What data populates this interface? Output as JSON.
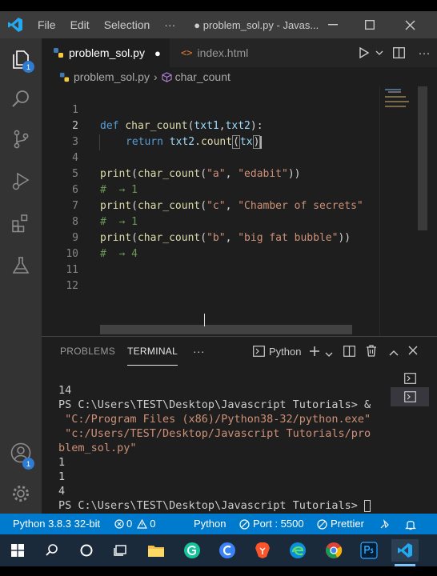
{
  "window": {
    "menu": [
      "File",
      "Edit",
      "Selection",
      "···"
    ],
    "title": "● problem_sol.py - Javas..."
  },
  "activity_bar": {
    "explorer_badge": "1",
    "accounts_badge": "1"
  },
  "tabs": [
    {
      "label": "problem_sol.py",
      "modified_marker": "●",
      "icon": "python-file-icon",
      "active": true
    },
    {
      "label": "index.html",
      "icon": "html-file-icon",
      "active": false
    }
  ],
  "breadcrumb": {
    "file": "problem_sol.py",
    "sep": "›",
    "symbol": "char_count"
  },
  "editor": {
    "line_numbers": [
      "1",
      "2",
      "3",
      "4",
      "5",
      "6",
      "7",
      "8",
      "9",
      "10",
      "11",
      "12"
    ],
    "lines": {
      "l1": {
        "kw": "def",
        "fn": "char_count",
        "p1": "(",
        "a1": "txt1",
        "c": ",",
        "a2": "txt2",
        "p2": "):"
      },
      "l2": {
        "kw": "return",
        "v": "txt2",
        "dot": ".",
        "fn": "count",
        "open": "(",
        "arg": "tx",
        "close": ")"
      },
      "l4": {
        "fn": "print",
        "p1": "(",
        "fn2": "char_count",
        "p2": "(",
        "s1": "\"a\"",
        "c": ", ",
        "s2": "\"edabit\"",
        "p3": "))"
      },
      "l5": {
        "cm": "#  → 1"
      },
      "l6": {
        "fn": "print",
        "p1": "(",
        "fn2": "char_count",
        "p2": "(",
        "s1": "\"c\"",
        "c": ", ",
        "s2": "\"Chamber of secrets\""
      },
      "l7": {
        "cm": "#  → 1"
      },
      "l8": {
        "fn": "print",
        "p1": "(",
        "fn2": "char_count",
        "p2": "(",
        "s1": "\"b\"",
        "c": ", ",
        "s2": "\"big fat bubble\"",
        "p3": "))"
      },
      "l9": {
        "cm": "#  → 4"
      }
    }
  },
  "panel": {
    "tabs": {
      "problems": "PROBLEMS",
      "terminal": "TERMINAL",
      "more": "···"
    },
    "shell": "Python",
    "terminal_lines": {
      "t1": "14",
      "t2": "PS C:\\Users\\TEST\\Desktop\\Javascript Tutorials> &",
      "t3": " \"C:/Program Files (x86)/Python38-32/python.exe\"",
      "t4": " \"c:/Users/TEST/Desktop/Javascript Tutorials/pro",
      "t5": "blem_sol.py\"",
      "t6": "1",
      "t7": "1",
      "t8": "4",
      "t9": "PS C:\\Users\\TEST\\Desktop\\Javascript Tutorials> "
    }
  },
  "status_bar": {
    "interpreter": "Python 3.8.3 32-bit",
    "errors": "0",
    "warnings": "0",
    "language": "Python",
    "port": "Port : 5500",
    "prettier": "Prettier"
  },
  "colors": {
    "accent": "#007acc",
    "keyword": "#569cd6",
    "function": "#dcdcaa",
    "variable": "#9cdcfe",
    "string": "#ce9178",
    "comment": "#6a9955"
  }
}
